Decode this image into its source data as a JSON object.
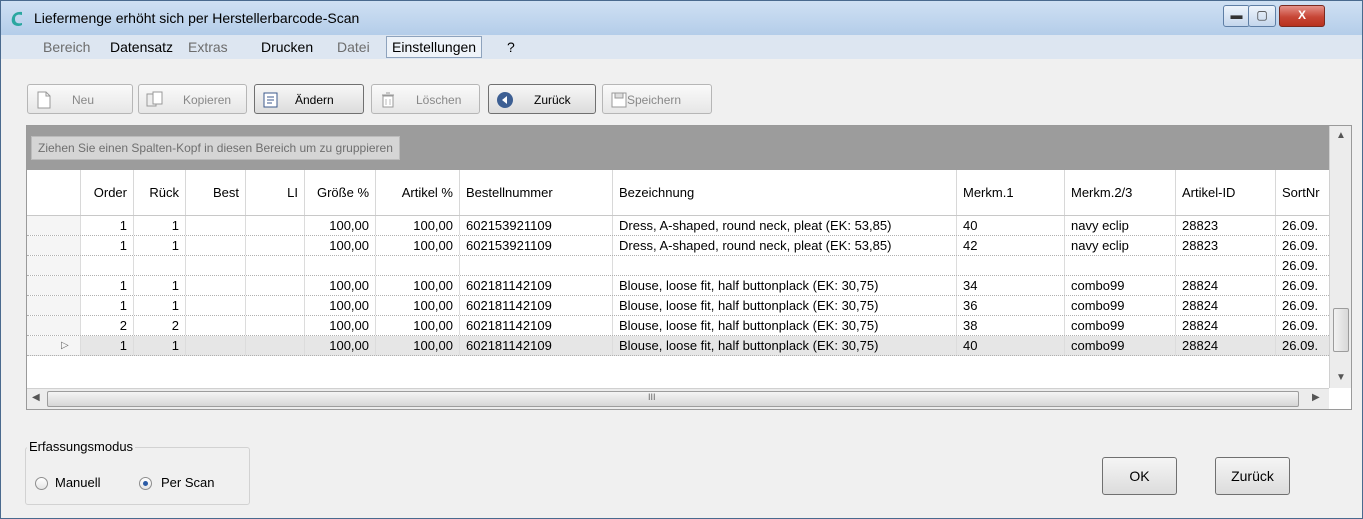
{
  "window": {
    "title": "Liefermenge erhöht sich per Herstellerbarcode-Scan",
    "min_glyph": "▬",
    "max_glyph": "▢",
    "close_glyph": "X"
  },
  "menu": [
    {
      "label": "Bereich",
      "enabled": false
    },
    {
      "label": "Datensatz",
      "enabled": true
    },
    {
      "label": "Extras",
      "enabled": false
    },
    {
      "label": "Drucken",
      "enabled": true
    },
    {
      "label": "Datei",
      "enabled": false
    },
    {
      "label": "Einstellungen",
      "enabled": true
    },
    {
      "label": "?",
      "enabled": true
    }
  ],
  "toolbar": {
    "new": "Neu",
    "copy": "Kopieren",
    "edit": "Ändern",
    "delete": "Löschen",
    "back": "Zurück",
    "save": "Speichern"
  },
  "grid": {
    "group_hint": "Ziehen Sie einen Spalten-Kopf in diesen Bereich um zu gruppieren",
    "columns": [
      "Order",
      "Rück",
      "Best",
      "LI",
      "Größe %",
      "Artikel %",
      "Bestellnummer",
      "Bezeichnung",
      "Merkm.1",
      "Merkm.2/3",
      "Artikel-ID",
      "SortNr"
    ],
    "rows": [
      {
        "order": "1",
        "rueck": "1",
        "best": "",
        "li": "",
        "groesse": "100,00",
        "artikel": "100,00",
        "bestellnummer": "602153921109",
        "bezeichnung": "Dress, A-shaped, round neck, pleat (EK: 53,85)",
        "merkm1": "40",
        "merkm23": "navy eclip",
        "artikel_id": "28823",
        "sortnr": "26.09."
      },
      {
        "order": "1",
        "rueck": "1",
        "best": "",
        "li": "",
        "groesse": "100,00",
        "artikel": "100,00",
        "bestellnummer": "602153921109",
        "bezeichnung": "Dress, A-shaped, round neck, pleat (EK: 53,85)",
        "merkm1": "42",
        "merkm23": "navy eclip",
        "artikel_id": "28823",
        "sortnr": "26.09."
      },
      {
        "order": "",
        "rueck": "",
        "best": "",
        "li": "",
        "groesse": "",
        "artikel": "",
        "bestellnummer": "",
        "bezeichnung": "",
        "merkm1": "",
        "merkm23": "",
        "artikel_id": "",
        "sortnr": "26.09."
      },
      {
        "order": "1",
        "rueck": "1",
        "best": "",
        "li": "",
        "groesse": "100,00",
        "artikel": "100,00",
        "bestellnummer": "602181142109",
        "bezeichnung": "Blouse, loose fit, half buttonplack (EK: 30,75)",
        "merkm1": "34",
        "merkm23": "combo99",
        "artikel_id": "28824",
        "sortnr": "26.09."
      },
      {
        "order": "1",
        "rueck": "1",
        "best": "",
        "li": "",
        "groesse": "100,00",
        "artikel": "100,00",
        "bestellnummer": "602181142109",
        "bezeichnung": "Blouse, loose fit, half buttonplack (EK: 30,75)",
        "merkm1": "36",
        "merkm23": "combo99",
        "artikel_id": "28824",
        "sortnr": "26.09."
      },
      {
        "order": "2",
        "rueck": "2",
        "best": "",
        "li": "",
        "groesse": "100,00",
        "artikel": "100,00",
        "bestellnummer": "602181142109",
        "bezeichnung": "Blouse, loose fit, half buttonplack (EK: 30,75)",
        "merkm1": "38",
        "merkm23": "combo99",
        "artikel_id": "28824",
        "sortnr": "26.09."
      },
      {
        "order": "1",
        "rueck": "1",
        "best": "",
        "li": "",
        "groesse": "100,00",
        "artikel": "100,00",
        "bestellnummer": "602181142109",
        "bezeichnung": "Blouse, loose fit, half buttonplack (EK: 30,75)",
        "merkm1": "40",
        "merkm23": "combo99",
        "artikel_id": "28824",
        "sortnr": "26.09.",
        "current": true
      }
    ],
    "current_row_marker": "▷",
    "hscroll_grip": "III"
  },
  "mode": {
    "legend": "Erfassungsmodus",
    "manual": "Manuell",
    "scan": "Per Scan",
    "selected": "scan"
  },
  "buttons": {
    "ok": "OK",
    "back": "Zurück"
  },
  "colors": {
    "title_gradient_top": "#cfe0f3",
    "group_bar": "#9c9c9c",
    "app_icon": "#2aa7a0",
    "close_button": "#c74636"
  }
}
